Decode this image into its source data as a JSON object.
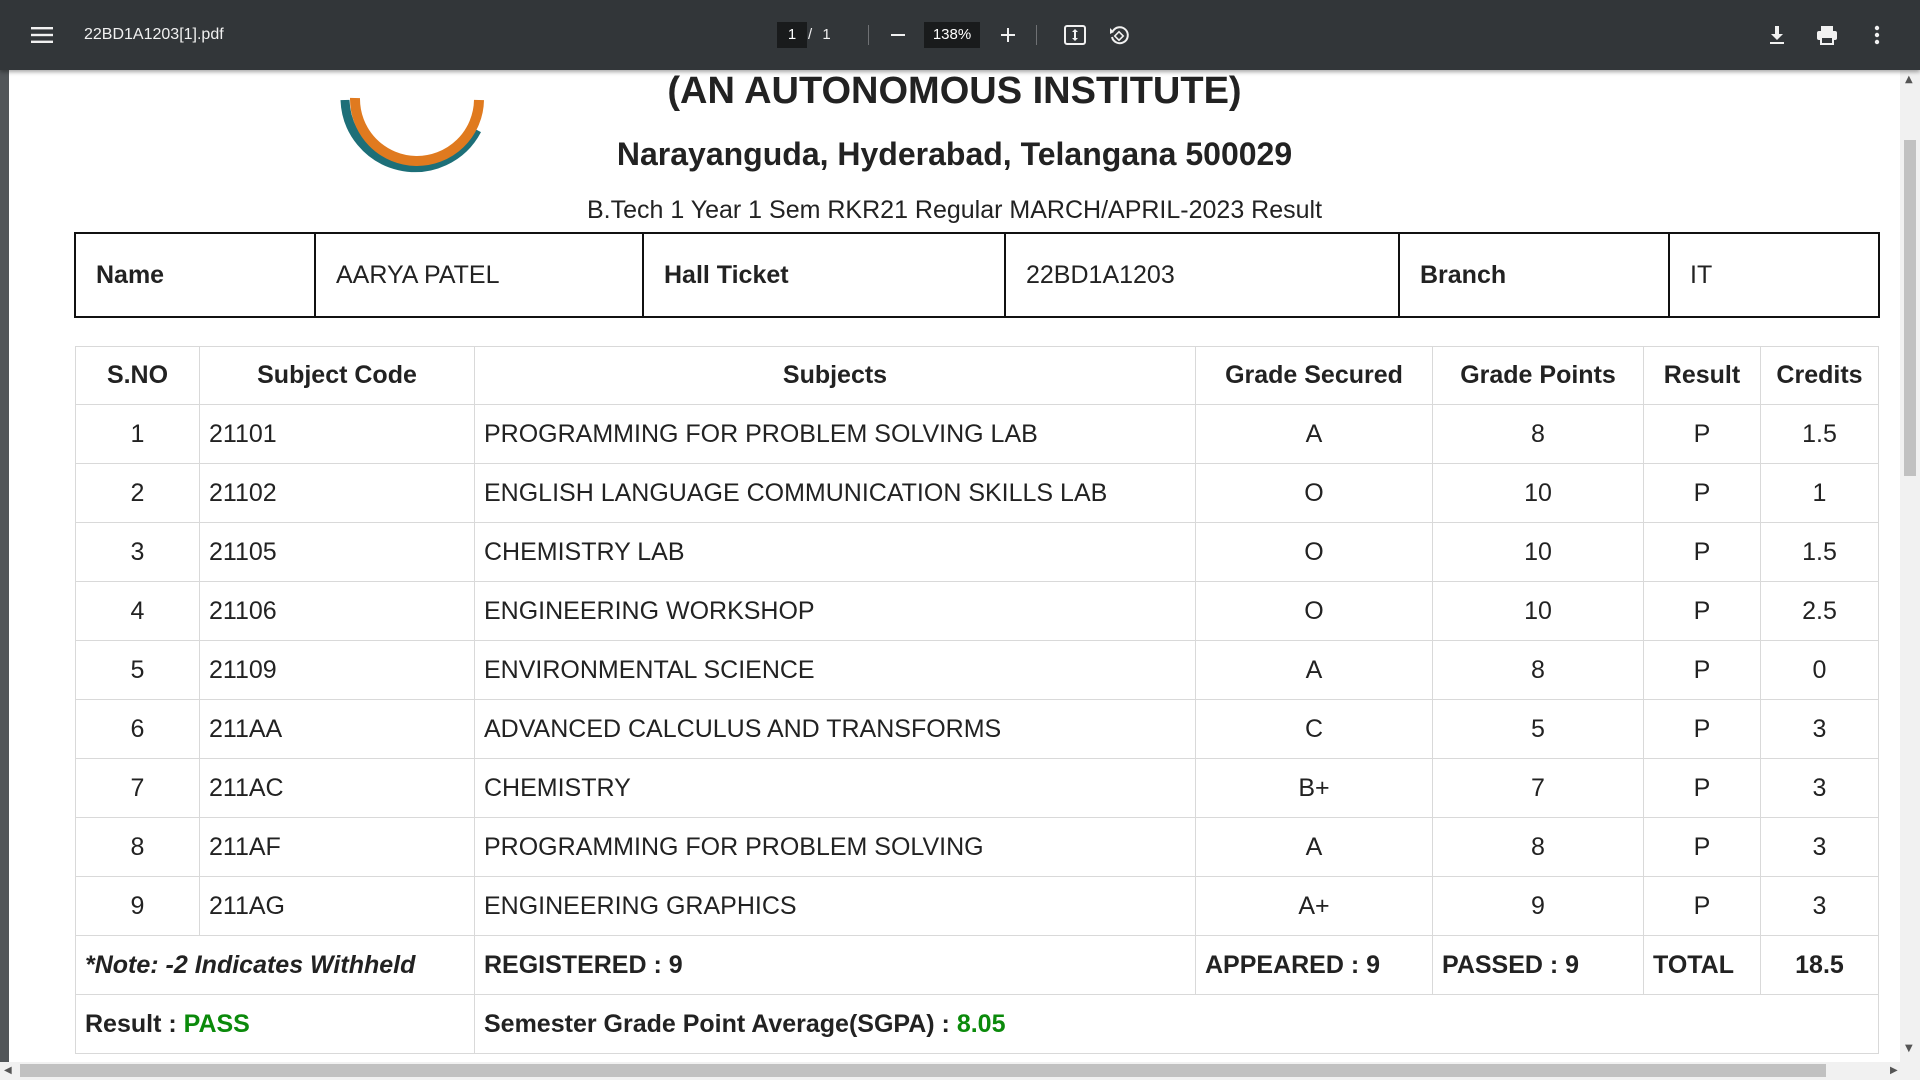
{
  "toolbar": {
    "menu_icon": "hamburger-menu-icon",
    "file_name": "22BD1A1203[1].pdf",
    "current_page": "1",
    "page_separator": "/ 1",
    "zoom": "138%",
    "zoom_out_icon": "minus-icon",
    "zoom_in_icon": "plus-icon",
    "fit_icon": "fit-to-page-icon",
    "rotate_icon": "rotate-icon",
    "download_icon": "download-icon",
    "print_icon": "print-icon",
    "more_icon": "more-vertical-icon"
  },
  "document": {
    "institute": "(AN AUTONOMOUS INSTITUTE)",
    "address": "Narayanguda, Hyderabad, Telangana 500029",
    "exam_title": "B.Tech 1 Year 1 Sem RKR21 Regular MARCH/APRIL-2023 Result",
    "student": {
      "name_label": "Name",
      "name": "AARYA PATEL",
      "hall_ticket_label": "Hall Ticket",
      "hall_ticket": "22BD1A1203",
      "branch_label": "Branch",
      "branch": "IT"
    },
    "columns": [
      "S.NO",
      "Subject Code",
      "Subjects",
      "Grade Secured",
      "Grade Points",
      "Result",
      "Credits"
    ],
    "rows": [
      {
        "sno": "1",
        "code": "21101",
        "subject": "PROGRAMMING FOR PROBLEM SOLVING LAB",
        "grade": "A",
        "points": "8",
        "result": "P",
        "credits": "1.5"
      },
      {
        "sno": "2",
        "code": "21102",
        "subject": "ENGLISH LANGUAGE COMMUNICATION SKILLS LAB",
        "grade": "O",
        "points": "10",
        "result": "P",
        "credits": "1"
      },
      {
        "sno": "3",
        "code": "21105",
        "subject": "CHEMISTRY LAB",
        "grade": "O",
        "points": "10",
        "result": "P",
        "credits": "1.5"
      },
      {
        "sno": "4",
        "code": "21106",
        "subject": "ENGINEERING WORKSHOP",
        "grade": "O",
        "points": "10",
        "result": "P",
        "credits": "2.5"
      },
      {
        "sno": "5",
        "code": "21109",
        "subject": "ENVIRONMENTAL SCIENCE",
        "grade": "A",
        "points": "8",
        "result": "P",
        "credits": "0"
      },
      {
        "sno": "6",
        "code": "211AA",
        "subject": "ADVANCED CALCULUS AND TRANSFORMS",
        "grade": "C",
        "points": "5",
        "result": "P",
        "credits": "3"
      },
      {
        "sno": "7",
        "code": "211AC",
        "subject": "CHEMISTRY",
        "grade": "B+",
        "points": "7",
        "result": "P",
        "credits": "3"
      },
      {
        "sno": "8",
        "code": "211AF",
        "subject": "PROGRAMMING FOR PROBLEM SOLVING",
        "grade": "A",
        "points": "8",
        "result": "P",
        "credits": "3"
      },
      {
        "sno": "9",
        "code": "211AG",
        "subject": "ENGINEERING GRAPHICS",
        "grade": "A+",
        "points": "9",
        "result": "P",
        "credits": "3"
      }
    ],
    "summary": {
      "note": "*Note: -2 Indicates Withheld",
      "registered": "REGISTERED : 9",
      "appeared": "APPEARED : 9",
      "passed": "PASSED : 9",
      "total_label": "TOTAL",
      "total_value": "18.5"
    },
    "result_line": {
      "result_label": "Result : ",
      "result_value": "PASS",
      "sgpa_label": "Semester Grade Point Average(SGPA) : ",
      "sgpa_value": "8.05"
    }
  },
  "colors": {
    "toolbar_bg": "#323639",
    "pass_green": "#0b8a0b",
    "logo_orange": "#e07a1f",
    "logo_teal": "#1d6f78"
  }
}
